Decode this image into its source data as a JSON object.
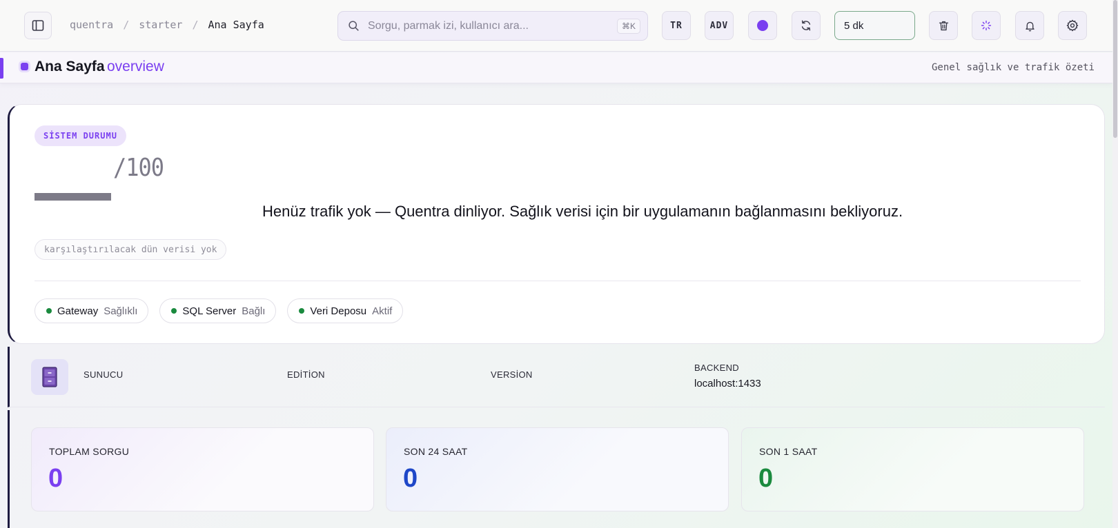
{
  "topbar": {
    "breadcrumb": [
      "quentra",
      "starter",
      "Ana Sayfa"
    ],
    "search_placeholder": "Sorgu, parmak izi, kullanıcı ara...",
    "search_shortcut": "⌘K",
    "lang_button": "TR",
    "mode_button": "ADV",
    "interval_value": "5 dk",
    "icons": [
      "sidebar-toggle-icon",
      "search-icon",
      "theme-dot-icon",
      "refresh-icon",
      "trash-icon",
      "spinner-icon",
      "bell-icon",
      "gear-icon"
    ]
  },
  "page_header": {
    "title": "Ana Sayfa",
    "subtitle": "overview",
    "description": "Genel sağlık ve trafik özeti"
  },
  "health": {
    "badge": "SİSTEM DURUMU",
    "score_value": "",
    "score_suffix": "/100",
    "empty_message": "Henüz trafik yok — Quentra dinliyor. Sağlık verisi için bir uygulamanın bağlanmasını bekliyoruz.",
    "comparison_note": "karşılaştırılacak dün verisi yok",
    "services": [
      {
        "name": "Gateway",
        "status": "Sağlıklı"
      },
      {
        "name": "SQL Server",
        "status": "Bağlı"
      },
      {
        "name": "Veri Deposu",
        "status": "Aktif"
      }
    ],
    "status_color": "#1a8a3e"
  },
  "server": {
    "labels": {
      "server": "SUNUCU",
      "edition": "EDİTİON",
      "version": "VERSİON",
      "backend": "BACKEND"
    },
    "values": {
      "server": "",
      "edition": "",
      "version": "",
      "backend": "localhost:1433"
    }
  },
  "stats": [
    {
      "label": "TOPLAM SORGU",
      "value": "0",
      "color": "#7a3ff0"
    },
    {
      "label": "SON 24 SAAT",
      "value": "0",
      "color": "#1e47c8"
    },
    {
      "label": "SON 1 SAAT",
      "value": "0",
      "color": "#1a8a3e"
    }
  ],
  "colors": {
    "accent": "#7a3ff0",
    "dark_accent": "#1e1b40"
  }
}
